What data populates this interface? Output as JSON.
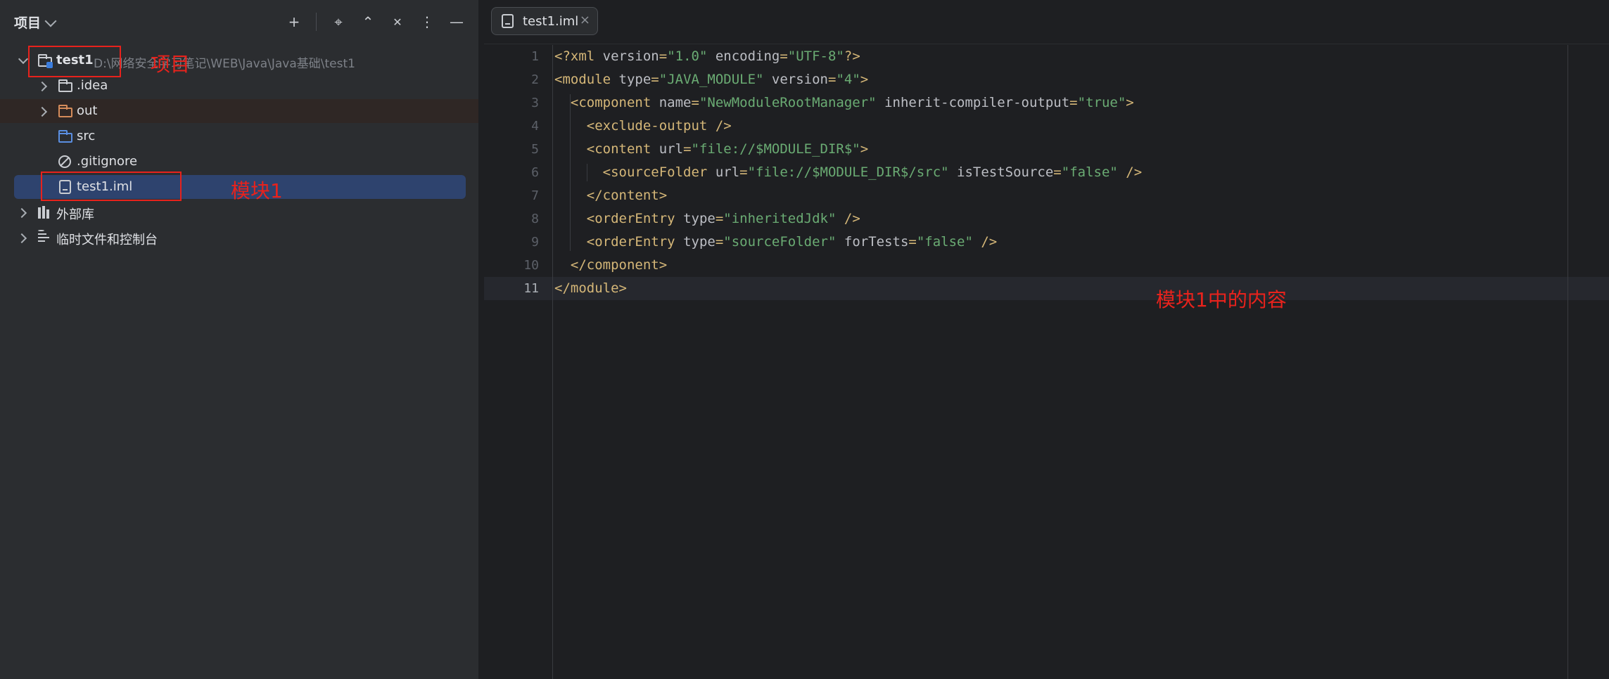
{
  "project_panel": {
    "title": "项目",
    "toolbar": {
      "icons": [
        "plus-icon",
        "target-icon",
        "expand-icon",
        "collapse-icon",
        "more-icon",
        "minimize-icon"
      ],
      "plus_glyph": "+",
      "target_glyph": "⌖",
      "expand_glyph": "⌃",
      "collapse_glyph": "✕",
      "more_glyph": "⋮",
      "minimize_glyph": "—"
    },
    "tree": {
      "root": {
        "label": "test1",
        "path": "D:\\网络安全学习笔记\\WEB\\Java\\Java基础\\test1"
      },
      "items": [
        {
          "label": ".idea"
        },
        {
          "label": "out"
        },
        {
          "label": "src"
        },
        {
          "label": ".gitignore"
        },
        {
          "label": "test1.iml"
        },
        {
          "label": "外部库"
        },
        {
          "label": "临时文件和控制台"
        }
      ]
    }
  },
  "annotations": {
    "project": "项目",
    "module": "模块1",
    "module_content": "模块1中的内容"
  },
  "editor": {
    "tab": {
      "label": "test1.iml",
      "close_glyph": "×"
    },
    "line_numbers": [
      "1",
      "2",
      "3",
      "4",
      "5",
      "6",
      "7",
      "8",
      "9",
      "10",
      "11"
    ],
    "lines": [
      {
        "indent": "",
        "parts": [
          [
            "punc",
            "<?"
          ],
          [
            "tag",
            "xml "
          ],
          [
            "attr",
            "version"
          ],
          [
            "punc",
            "="
          ],
          [
            "val",
            "\"1.0\""
          ],
          [
            "attr",
            " encoding"
          ],
          [
            "punc",
            "="
          ],
          [
            "val",
            "\"UTF-8\""
          ],
          [
            "punc",
            "?>"
          ]
        ]
      },
      {
        "indent": "",
        "parts": [
          [
            "punc",
            "<"
          ],
          [
            "tag",
            "module "
          ],
          [
            "attr",
            "type"
          ],
          [
            "punc",
            "="
          ],
          [
            "val",
            "\"JAVA_MODULE\""
          ],
          [
            "attr",
            " version"
          ],
          [
            "punc",
            "="
          ],
          [
            "val",
            "\"4\""
          ],
          [
            "punc",
            ">"
          ]
        ]
      },
      {
        "indent": "  ",
        "parts": [
          [
            "punc",
            "<"
          ],
          [
            "tag",
            "component "
          ],
          [
            "attr",
            "name"
          ],
          [
            "punc",
            "="
          ],
          [
            "val",
            "\"NewModuleRootManager\""
          ],
          [
            "attr",
            " inherit-compiler-output"
          ],
          [
            "punc",
            "="
          ],
          [
            "val",
            "\"true\""
          ],
          [
            "punc",
            ">"
          ]
        ]
      },
      {
        "indent": "    ",
        "parts": [
          [
            "punc",
            "<"
          ],
          [
            "tag",
            "exclude-output "
          ],
          [
            "punc",
            "/>"
          ]
        ]
      },
      {
        "indent": "    ",
        "parts": [
          [
            "punc",
            "<"
          ],
          [
            "tag",
            "content "
          ],
          [
            "attr",
            "url"
          ],
          [
            "punc",
            "="
          ],
          [
            "val",
            "\"file://$MODULE_DIR$\""
          ],
          [
            "punc",
            ">"
          ]
        ]
      },
      {
        "indent": "      ",
        "parts": [
          [
            "punc",
            "<"
          ],
          [
            "tag",
            "sourceFolder "
          ],
          [
            "attr",
            "url"
          ],
          [
            "punc",
            "="
          ],
          [
            "val",
            "\"file://$MODULE_DIR$/src\""
          ],
          [
            "attr",
            " isTestSource"
          ],
          [
            "punc",
            "="
          ],
          [
            "val",
            "\"false\""
          ],
          [
            "punc",
            " />"
          ]
        ]
      },
      {
        "indent": "    ",
        "parts": [
          [
            "punc",
            "</"
          ],
          [
            "tag",
            "content"
          ],
          [
            "punc",
            ">"
          ]
        ]
      },
      {
        "indent": "    ",
        "parts": [
          [
            "punc",
            "<"
          ],
          [
            "tag",
            "orderEntry "
          ],
          [
            "attr",
            "type"
          ],
          [
            "punc",
            "="
          ],
          [
            "val",
            "\"inheritedJdk\""
          ],
          [
            "punc",
            " />"
          ]
        ]
      },
      {
        "indent": "    ",
        "parts": [
          [
            "punc",
            "<"
          ],
          [
            "tag",
            "orderEntry "
          ],
          [
            "attr",
            "type"
          ],
          [
            "punc",
            "="
          ],
          [
            "val",
            "\"sourceFolder\""
          ],
          [
            "attr",
            " forTests"
          ],
          [
            "punc",
            "="
          ],
          [
            "val",
            "\"false\""
          ],
          [
            "punc",
            " />"
          ]
        ]
      },
      {
        "indent": "  ",
        "parts": [
          [
            "punc",
            "</"
          ],
          [
            "tag",
            "component"
          ],
          [
            "punc",
            ">"
          ]
        ]
      },
      {
        "indent": "",
        "parts": [
          [
            "punc",
            "</"
          ],
          [
            "tag",
            "module"
          ],
          [
            "punc",
            ">"
          ]
        ]
      }
    ],
    "current_line": 11
  },
  "colors": {
    "panel_bg": "#2b2d30",
    "editor_bg": "#1e1f22",
    "selection": "#2e436e",
    "annotation_red": "#e8221c",
    "xml_tag": "#d5b778",
    "xml_value": "#6aab73"
  }
}
